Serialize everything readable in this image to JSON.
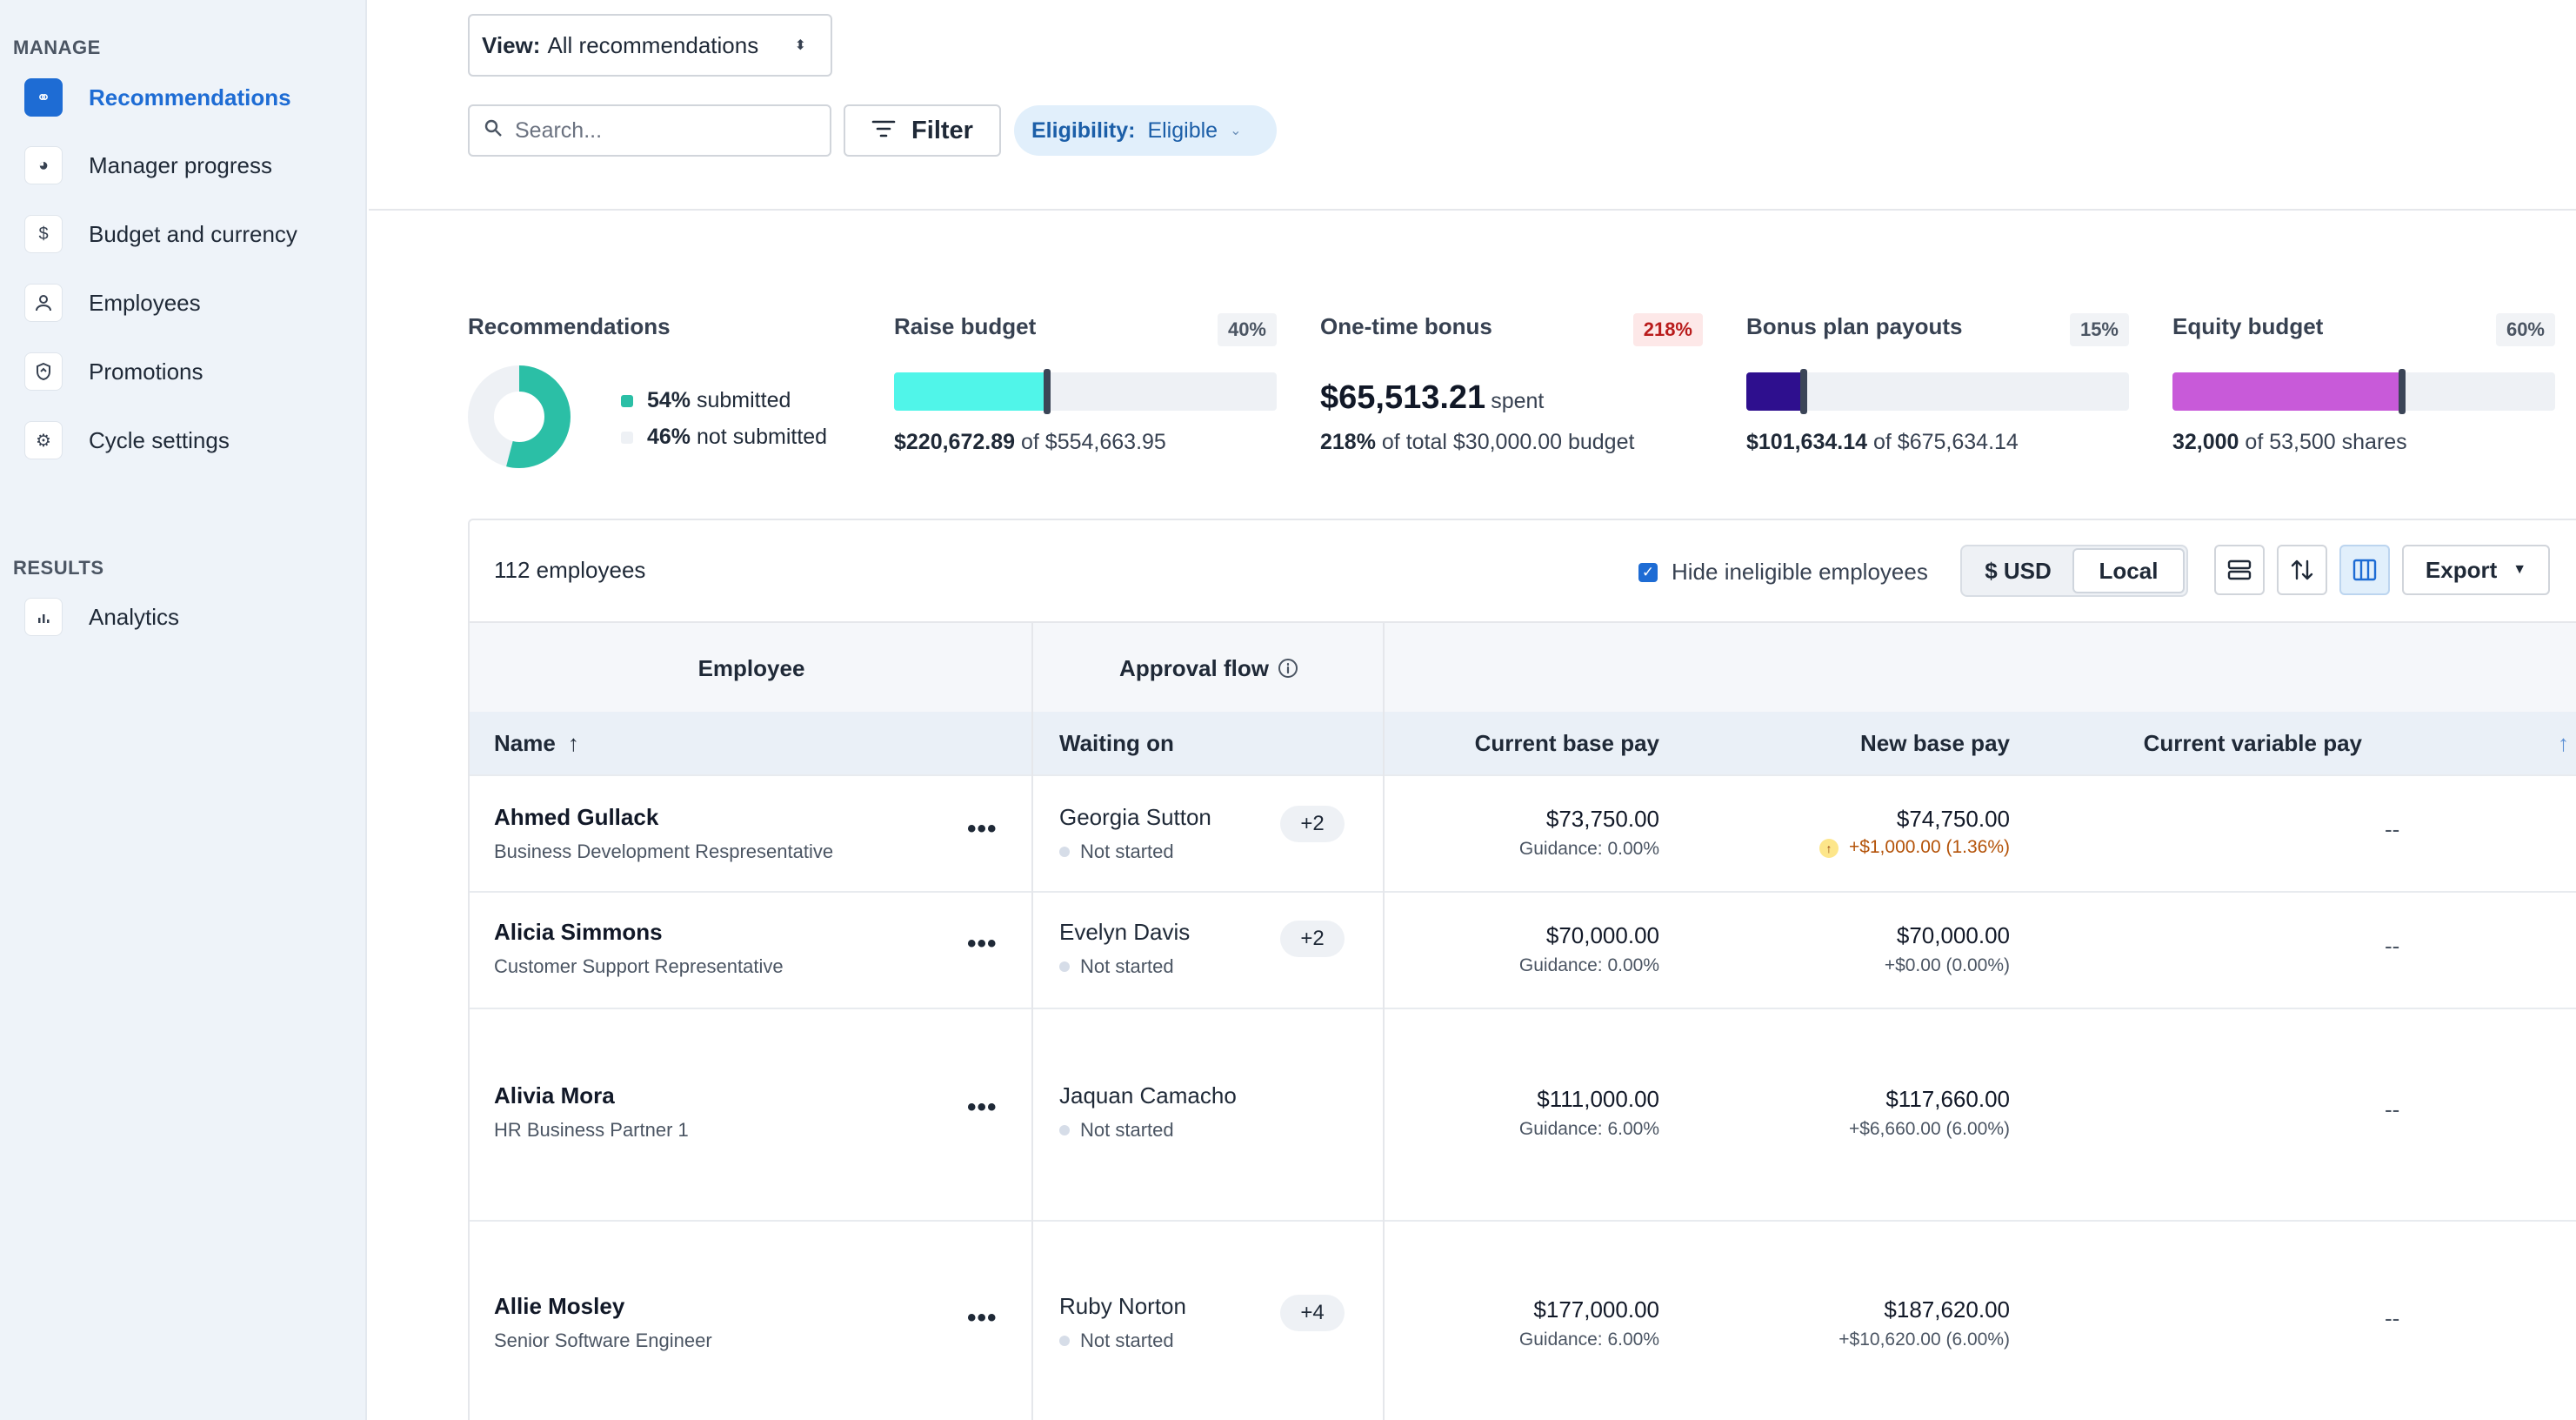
{
  "sidebar": {
    "manage_title": "MANAGE",
    "manage_items": [
      {
        "label": "Recommendations",
        "icon": "link-icon"
      },
      {
        "label": "Manager progress",
        "icon": "progress-pie-icon"
      },
      {
        "label": "Budget and currency",
        "icon": "dollar-icon"
      },
      {
        "label": "Employees",
        "icon": "person-icon"
      },
      {
        "label": "Promotions",
        "icon": "badge-icon"
      },
      {
        "label": "Cycle settings",
        "icon": "gear-icon"
      }
    ],
    "results_title": "RESULTS",
    "results_items": [
      {
        "label": "Analytics",
        "icon": "bar-chart-icon"
      }
    ]
  },
  "toolbar": {
    "view_prefix": "View:",
    "view_value": "All recommendations",
    "search_placeholder": "Search...",
    "filter_label": "Filter",
    "eligibility_label": "Eligibility:",
    "eligibility_value": "Eligible"
  },
  "summary": {
    "recommendations": {
      "title": "Recommendations",
      "submitted_pct": "54%",
      "submitted_label": "submitted",
      "not_submitted_pct": "46%",
      "not_submitted_label": "not submitted",
      "submitted_fraction": 0.54,
      "submitted_color": "#2bbfa6",
      "not_submitted_color": "#eef1f5"
    },
    "raise_budget": {
      "title": "Raise budget",
      "badge": "40%",
      "spent": "$220,672.89",
      "of_text": "of",
      "total": "$554,663.95",
      "fraction": 0.4,
      "color": "#50f5e9"
    },
    "one_time_bonus": {
      "title": "One-time bonus",
      "badge": "218%",
      "amount": "$65,513.21",
      "amount_suffix": "spent",
      "pct": "218%",
      "detail": "of total $30,000.00 budget"
    },
    "bonus_plan": {
      "title": "Bonus plan payouts",
      "badge": "15%",
      "spent": "$101,634.14",
      "of_text": "of",
      "total": "$675,634.14",
      "fraction": 0.15,
      "color": "#2e0f8e"
    },
    "equity_budget": {
      "title": "Equity budget",
      "badge": "60%",
      "spent": "32,000",
      "of_text": "of",
      "total": "53,500 shares",
      "fraction": 0.6,
      "color": "#c85ad9"
    }
  },
  "table": {
    "employee_count": "112 employees",
    "hide_ineligible_label": "Hide ineligible employees",
    "hide_ineligible_checked": true,
    "currency_usd": "$ USD",
    "currency_local": "Local",
    "export_label": "Export",
    "group_headers": {
      "employee": "Employee",
      "approval": "Approval flow"
    },
    "columns": {
      "name": "Name",
      "waiting_on": "Waiting on",
      "current_base": "Current base pay",
      "new_base": "New base pay",
      "current_variable": "Current variable pay"
    },
    "rows": [
      {
        "name": "Ahmed Gullack",
        "title": "Business Development Respresentative",
        "approver": "Georgia Sutton",
        "status": "Not started",
        "extra": "+2",
        "current_base": "$73,750.00",
        "guidance": "Guidance: 0.00%",
        "new_base": "$74,750.00",
        "change": "+$1,000.00 (1.36%)",
        "change_flag": true,
        "variable": "--"
      },
      {
        "name": "Alicia Simmons",
        "title": "Customer Support Representative",
        "approver": "Evelyn Davis",
        "status": "Not started",
        "extra": "+2",
        "current_base": "$70,000.00",
        "guidance": "Guidance: 0.00%",
        "new_base": "$70,000.00",
        "change": "+$0.00 (0.00%)",
        "change_flag": false,
        "variable": "--"
      },
      {
        "name": "Alivia Mora",
        "title": "HR Business Partner 1",
        "approver": "Jaquan Camacho",
        "status": "Not started",
        "extra": "",
        "current_base": "$111,000.00",
        "guidance": "Guidance: 6.00%",
        "new_base": "$117,660.00",
        "change": "+$6,660.00 (6.00%)",
        "change_flag": false,
        "variable": "--"
      },
      {
        "name": "Allie Mosley",
        "title": "Senior Software Engineer",
        "approver": "Ruby Norton",
        "status": "Not started",
        "extra": "+4",
        "current_base": "$177,000.00",
        "guidance": "Guidance: 6.00%",
        "new_base": "$187,620.00",
        "change": "+$10,620.00 (6.00%)",
        "change_flag": false,
        "variable": "--"
      }
    ]
  }
}
